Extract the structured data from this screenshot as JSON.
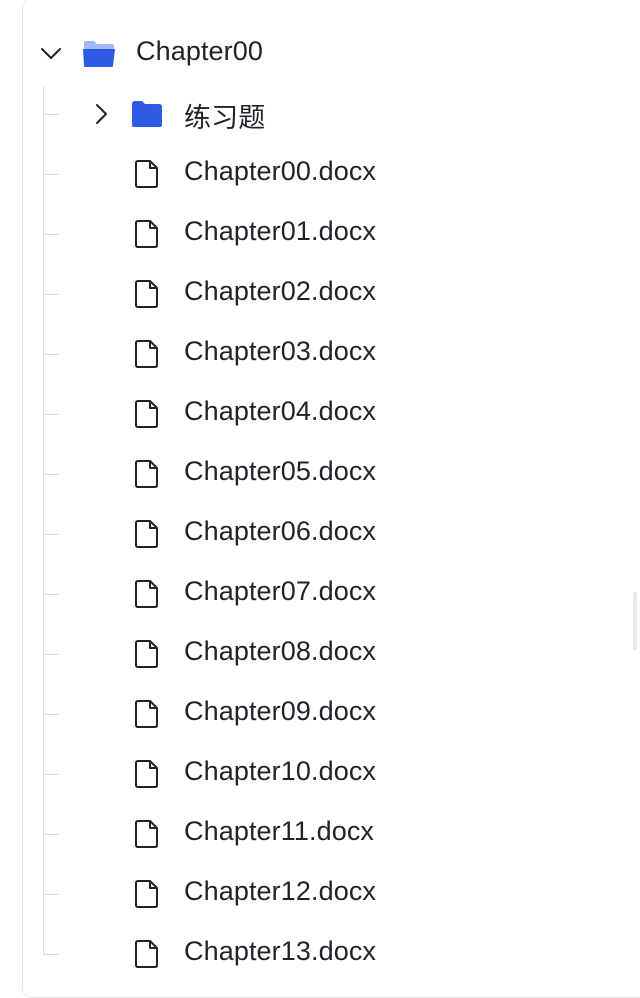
{
  "tree": {
    "root": {
      "label": "Chapter00",
      "expanded": true,
      "icon": "folder-open-icon"
    },
    "subfolder": {
      "label": "练习题",
      "expanded": false,
      "icon": "folder-icon"
    },
    "files": [
      {
        "label": "Chapter00.docx",
        "icon": "file-icon"
      },
      {
        "label": "Chapter01.docx",
        "icon": "file-icon"
      },
      {
        "label": "Chapter02.docx",
        "icon": "file-icon"
      },
      {
        "label": "Chapter03.docx",
        "icon": "file-icon"
      },
      {
        "label": "Chapter04.docx",
        "icon": "file-icon"
      },
      {
        "label": "Chapter05.docx",
        "icon": "file-icon"
      },
      {
        "label": "Chapter06.docx",
        "icon": "file-icon"
      },
      {
        "label": "Chapter07.docx",
        "icon": "file-icon"
      },
      {
        "label": "Chapter08.docx",
        "icon": "file-icon"
      },
      {
        "label": "Chapter09.docx",
        "icon": "file-icon"
      },
      {
        "label": "Chapter10.docx",
        "icon": "file-icon"
      },
      {
        "label": "Chapter11.docx",
        "icon": "file-icon"
      },
      {
        "label": "Chapter12.docx",
        "icon": "file-icon"
      },
      {
        "label": "Chapter13.docx",
        "icon": "file-icon"
      }
    ]
  },
  "colors": {
    "folder_open": "#6b8cf0",
    "folder": "#2d5be3",
    "text": "#1f2329",
    "icon_stroke": "#1f2329",
    "guide": "#dcdde1"
  }
}
